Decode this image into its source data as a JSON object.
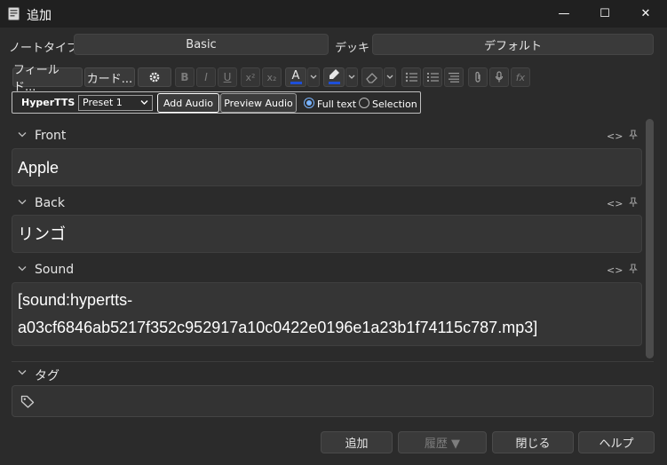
{
  "window": {
    "title": "追加",
    "minimize_glyph": "—",
    "maximize_glyph": "☐",
    "close_glyph": "✕"
  },
  "notetype": {
    "label": "ノートタイプ",
    "value": "Basic"
  },
  "deck": {
    "label": "デッキ",
    "value": "デフォルト"
  },
  "toolbar": {
    "fields_button": "フィールド...",
    "cards_button": "カード...",
    "icons": [
      "gear-icon",
      "bold-icon",
      "italic-icon",
      "underline-icon",
      "superscript-icon",
      "subscript-icon",
      "text-color-icon",
      "highlight-icon",
      "eraser-icon",
      "unordered-list-icon",
      "ordered-list-icon",
      "align-icon",
      "paperclip-icon",
      "microphone-icon",
      "function-icon"
    ],
    "bold": "B",
    "italic": "I",
    "underline": "U",
    "superscript": "x²",
    "subscript": "x₂",
    "text_color": "A",
    "function": "fx",
    "text_color_swatch": "#1e4fd8",
    "highlight_swatch": "#1e4fd8"
  },
  "hypertts": {
    "label": "HyperTTS",
    "preset": "Preset 1",
    "add_audio": "Add Audio",
    "preview_audio": "Preview Audio",
    "full_text": "Full text",
    "selection": "Selection",
    "selected_mode": "Full text"
  },
  "fields": [
    {
      "name": "Front",
      "value": "Apple"
    },
    {
      "name": "Back",
      "value": "リンゴ"
    },
    {
      "name": "Sound",
      "value_line1": "[sound:hypertts-",
      "value_line2": "a03cf6846ab5217f352c952917a10c0422e0196e1a23b1f74115c787.mp3]"
    }
  ],
  "field_icons": {
    "code": "<>"
  },
  "tags": {
    "label": "タグ"
  },
  "buttons": {
    "add": "追加",
    "history": "履歴 ▼",
    "close": "閉じる",
    "help": "ヘルプ"
  },
  "colors": {
    "background": "#2b2b2b",
    "titlebar": "#202020",
    "accent": "#79b4ff"
  }
}
